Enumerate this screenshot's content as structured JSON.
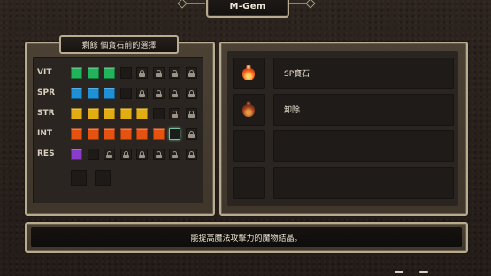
{
  "window": {
    "title": "M-Gem"
  },
  "gem_panel": {
    "header": "剩餘 個寶石前的選擇",
    "rows": [
      {
        "label": "VIT",
        "color": "#22b45a",
        "filled": 3,
        "empty": 1,
        "locked": 4
      },
      {
        "label": "SPR",
        "color": "#1f8fd6",
        "filled": 3,
        "empty": 1,
        "locked": 4
      },
      {
        "label": "STR",
        "color": "#e2ad12",
        "filled": 5,
        "empty": 1,
        "locked": 2
      },
      {
        "label": "INT",
        "color": "#e65310",
        "filled": 6,
        "selected": 1,
        "locked": 1
      },
      {
        "label": "RES",
        "color": "#8a3bc9",
        "filled": 1,
        "empty": 1,
        "locked": 6
      }
    ]
  },
  "item_list": [
    {
      "icon": "sp-gem-icon",
      "label": "SP寶石"
    },
    {
      "icon": "remove-gem-icon",
      "label": "卸除"
    },
    {
      "icon": "",
      "label": ""
    },
    {
      "icon": "",
      "label": ""
    }
  ],
  "description": "能提高魔法攻擊力的魔物結晶。"
}
